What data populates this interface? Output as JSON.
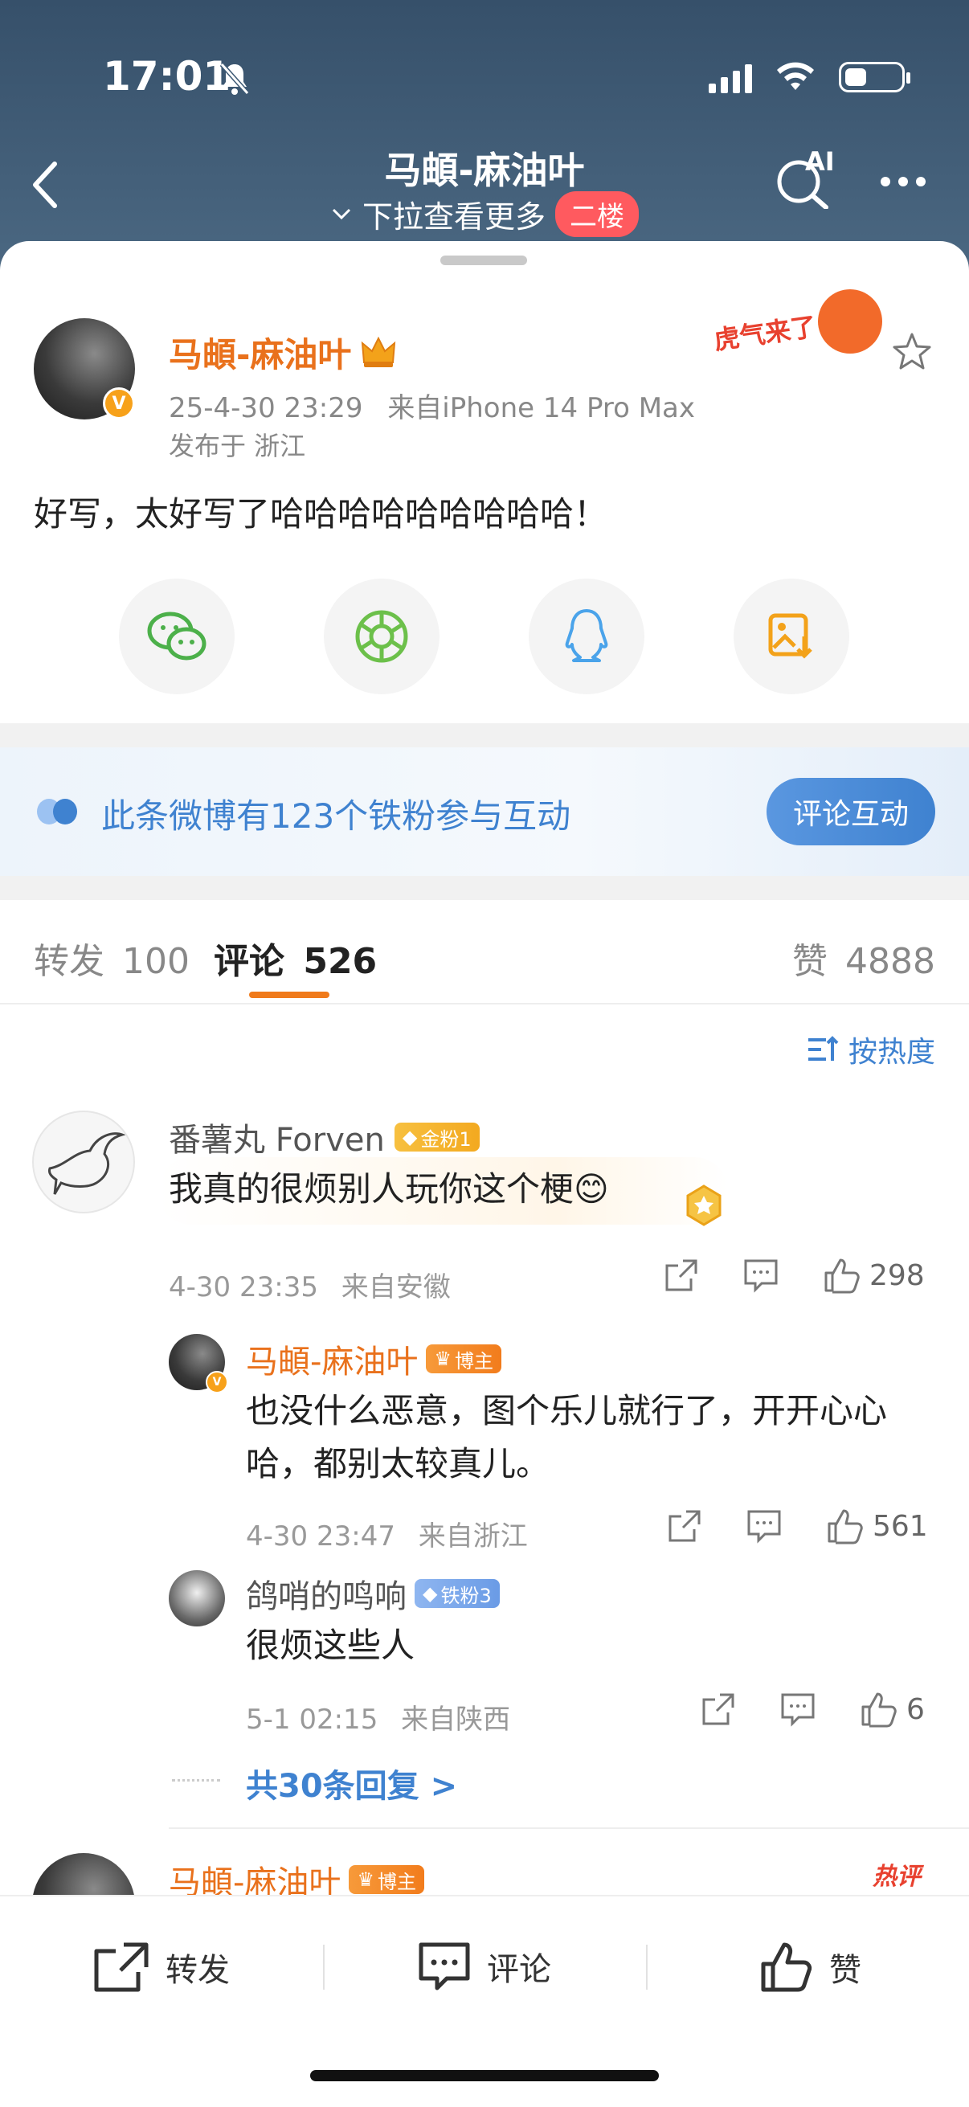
{
  "status_bar": {
    "time": "17:01"
  },
  "nav": {
    "title": "马頔-麻油叶",
    "subtitle": "下拉查看更多",
    "floor_badge": "二楼",
    "ai_label": "AI"
  },
  "post": {
    "author": "马頔-麻油叶",
    "timestamp": "25-4-30 23:29",
    "source": "来自iPhone 14 Pro Max",
    "location": "发布于 浙江",
    "sticker_text": "虎气来了",
    "text": "好写，太好写了哈哈哈哈哈哈哈哈哈！",
    "share_targets": [
      "wechat-icon",
      "moments-icon",
      "qq-icon",
      "save-image-icon"
    ]
  },
  "banner": {
    "text": "此条微博有123个铁粉参与互动",
    "button": "评论互动"
  },
  "tabs": {
    "repost_label": "转发",
    "repost_count": "100",
    "comment_label": "评论",
    "comment_count": "526",
    "like_label": "赞",
    "like_count": "4888"
  },
  "sort": {
    "label": "按热度"
  },
  "comments": [
    {
      "name": "番薯丸 Forven",
      "badge": "金粉1",
      "text": "我真的很烦别人玩你这个梗😊",
      "time": "4-30 23:35",
      "source": "来自安徽",
      "likes": "298",
      "replies": [
        {
          "name": "马頔-麻油叶",
          "badge": "博主",
          "text_line1": "也没什么恶意，图个乐儿就行了，开开心心",
          "text_line2": "哈，都别太较真儿。",
          "time": "4-30 23:47",
          "source": "来自浙江",
          "likes": "561"
        },
        {
          "name": "鸽哨的鸣响",
          "badge": "铁粉3",
          "text": "很烦这些人",
          "time": "5-1 02:15",
          "source": "来自陕西",
          "likes": "6"
        }
      ],
      "more_replies": "共30条回复 >"
    },
    {
      "name": "马頔-麻油叶",
      "badge": "博主",
      "hot_tag": "热评"
    }
  ],
  "bottom_bar": {
    "repost": "转发",
    "comment": "评论",
    "like": "赞"
  },
  "colors": {
    "header_bg": "#3e5a75",
    "accent_orange": "#e9711c",
    "accent_blue": "#3f82d0"
  }
}
